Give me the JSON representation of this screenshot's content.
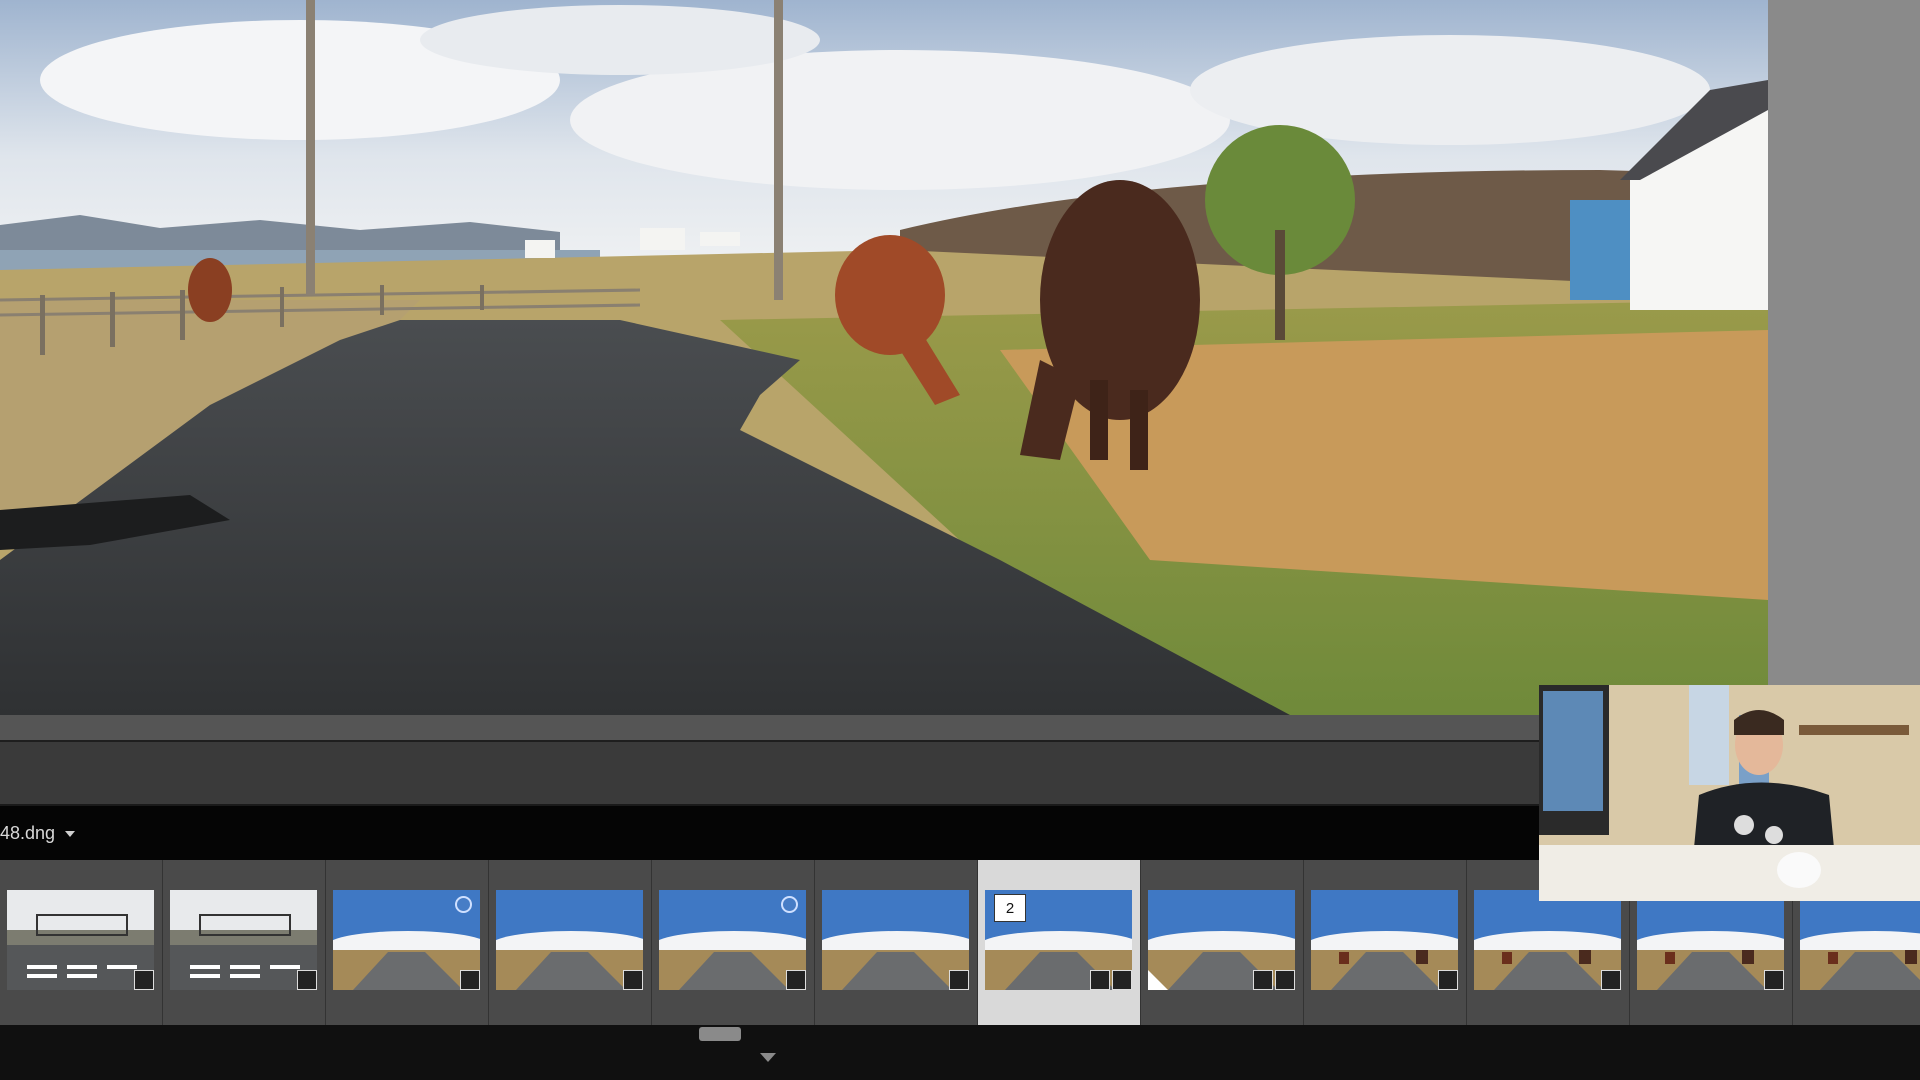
{
  "filename": {
    "text": "48.dng",
    "dropdown_icon": "chevron-down-icon"
  },
  "filmstrip": {
    "thumbnails": [
      {
        "scene": "gate",
        "badges": [
          "develop-icon"
        ],
        "selected": false
      },
      {
        "scene": "gate",
        "badges": [
          "develop-icon"
        ],
        "selected": false
      },
      {
        "scene": "road",
        "badges": [
          "develop-icon"
        ],
        "selected": false,
        "marker": "circle"
      },
      {
        "scene": "road",
        "badges": [
          "develop-icon"
        ],
        "selected": false
      },
      {
        "scene": "road",
        "badges": [
          "develop-icon"
        ],
        "selected": false,
        "marker": "circle"
      },
      {
        "scene": "road",
        "badges": [
          "develop-icon"
        ],
        "selected": false
      },
      {
        "scene": "road",
        "badges": [
          "develop-icon",
          "crop-icon"
        ],
        "selected": true,
        "stack_count": "2"
      },
      {
        "scene": "road",
        "badges": [
          "develop-icon",
          "crop-icon"
        ],
        "selected": false,
        "flag": true
      },
      {
        "scene": "cows",
        "badges": [
          "develop-icon"
        ],
        "selected": false
      },
      {
        "scene": "cows",
        "badges": [
          "develop-icon"
        ],
        "selected": false
      },
      {
        "scene": "cows",
        "badges": [
          "develop-icon"
        ],
        "selected": false
      },
      {
        "scene": "cows",
        "badges": [
          "develop-icon"
        ],
        "selected": false
      }
    ]
  },
  "colors": {
    "accent": "#d9d9d9",
    "panel": "#434343",
    "background": "#111111"
  }
}
